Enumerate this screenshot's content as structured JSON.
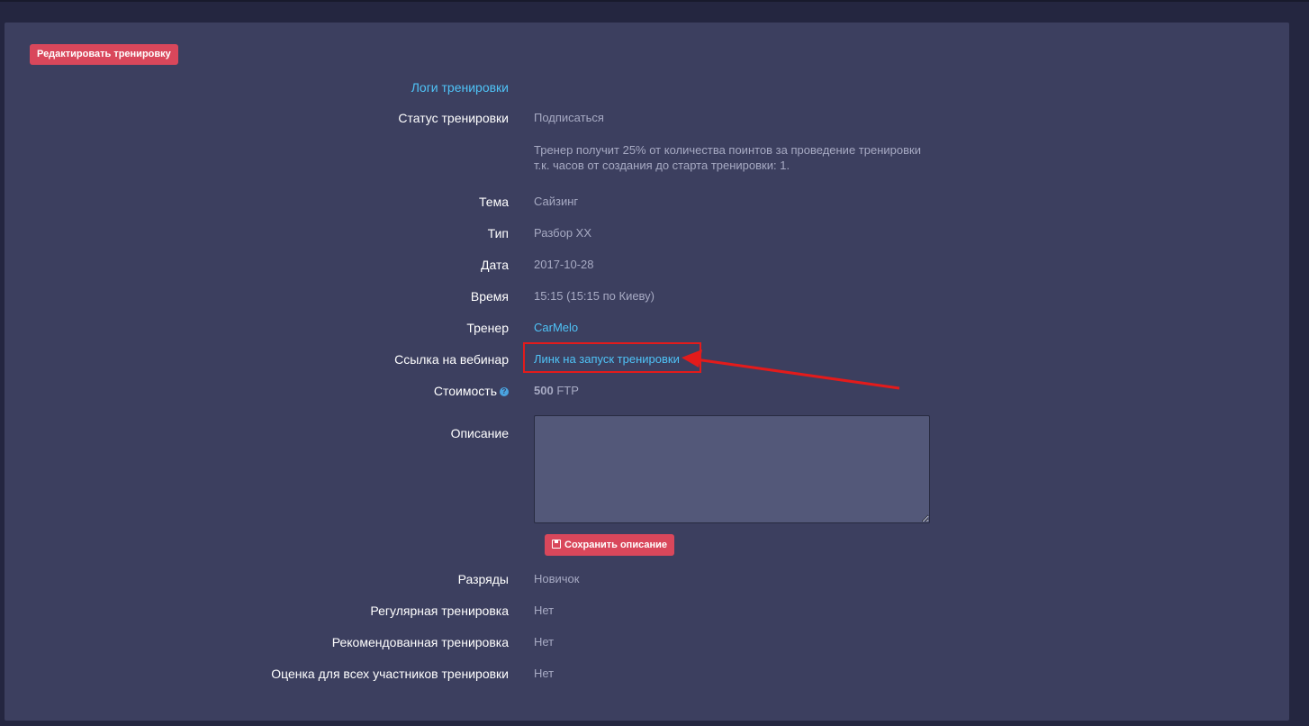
{
  "toolbar": {
    "edit_label": "Редактировать тренировку"
  },
  "logs_link": "Логи тренировки",
  "fields": {
    "status": {
      "label": "Статус тренировки",
      "value": "Подписаться"
    },
    "note_line1": "Тренер получит 25% от количества поинтов за проведение тренировки",
    "note_line2": "т.к. часов от создания до старта тренировки: 1.",
    "topic": {
      "label": "Тема",
      "value": "Сайзинг"
    },
    "type": {
      "label": "Тип",
      "value": "Разбор ХХ"
    },
    "date": {
      "label": "Дата",
      "value": "2017-10-28"
    },
    "time": {
      "label": "Время",
      "value": "15:15 (15:15 по Киеву)"
    },
    "coach": {
      "label": "Тренер",
      "value": "CarMelo"
    },
    "webinar": {
      "label": "Ссылка на вебинар",
      "value": "Линк на запуск тренировки"
    },
    "cost": {
      "label": "Стоимость",
      "amount": "500",
      "currency": "FTP",
      "help_icon": "?"
    },
    "description": {
      "label": "Описание",
      "value": ""
    },
    "save_label": "Сохранить описание",
    "ranks": {
      "label": "Разряды",
      "value": "Новичок"
    },
    "regular": {
      "label": "Регулярная тренировка",
      "value": "Нет"
    },
    "recommended": {
      "label": "Рекомендованная тренировка",
      "value": "Нет"
    },
    "rating_all": {
      "label": "Оценка для всех участников тренировки",
      "value": "Нет"
    }
  },
  "colors": {
    "background": "#242640",
    "panel": "#3c3f5f",
    "accent_button": "#d9475b",
    "link": "#4fc3f7",
    "annotation": "#e31b1b"
  }
}
